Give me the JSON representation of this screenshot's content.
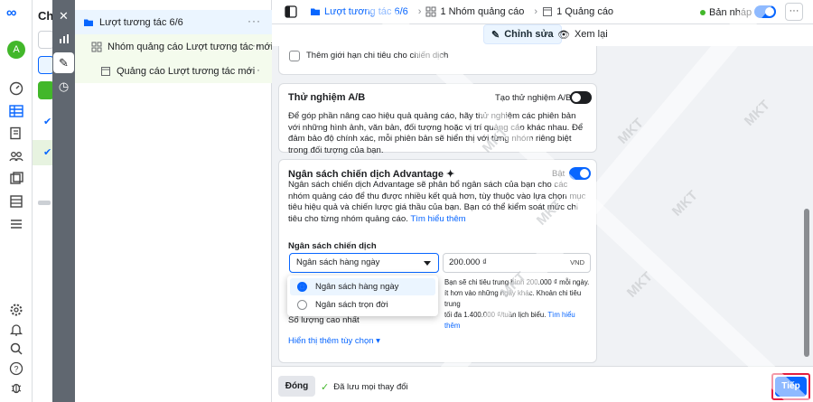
{
  "nav_rail": {
    "avatar_letter": "A",
    "icons": [
      "meta-logo-icon",
      "dashboard-icon",
      "table-icon",
      "documents-icon",
      "audience-icon",
      "catalog-icon",
      "billing-icon",
      "menu-icon",
      "settings-icon",
      "notifications-icon",
      "search-icon",
      "help-icon",
      "bug-icon"
    ]
  },
  "campaign_list": {
    "title": "Chi"
  },
  "tree": {
    "campaign": "Lượt tương tác 6/6",
    "ad_set": "Nhóm quảng cáo Lượt tương tác mới",
    "ad": "Quảng cáo Lượt tương tác mới",
    "more": "···"
  },
  "topbar": {
    "crumb_campaign": "Lượt tương tác 6/6",
    "crumb_adsets": "1 Nhóm quảng cáo",
    "crumb_ads": "1 Quảng cáo",
    "status": "Bản nháp",
    "more": "···"
  },
  "modes": {
    "edit": "Chỉnh sửa",
    "review": "Xem lại"
  },
  "spend_limit": {
    "label": "Thêm giới hạn chi tiêu cho chiến dịch"
  },
  "ab_test": {
    "title": "Thử nghiệm A/B",
    "toggle_label": "Tạo thử nghiệm A/B",
    "description": "Để góp phần nâng cao hiệu quả quảng cáo, hãy thử nghiệm các phiên bản với những hình ảnh, văn bản, đối tượng hoặc vị trí quảng cáo khác nhau. Để đảm bảo độ chính xác, mỗi phiên bản sẽ hiển thị với từng nhóm riêng biệt trong đối tượng của bạn."
  },
  "advantage_budget": {
    "title": "Ngân sách chiến dịch Advantage ✦",
    "toggle_label": "Bật",
    "description": "Ngân sách chiến dịch Advantage sẽ phân bổ ngân sách của bạn cho các nhóm quảng cáo để thu được nhiều kết quả hơn, tùy thuộc vào lựa chọn mục tiêu hiệu quả và chiến lược giá thầu của bạn. Bạn có thể kiểm soát mức chi tiêu cho từng nhóm quảng cáo.",
    "learn_more": "Tìm hiểu thêm",
    "budget_label": "Ngân sách chiến dịch",
    "selected_budget": "Ngân sách hàng ngày",
    "amount": "200.000 ₫",
    "currency": "VND",
    "note_line1": "Bạn sẽ chi tiêu trung bình 200.000 ₫ mỗi ngày. Bạn có thể chi tiêu nhiều",
    "note_line2": "ít hơn vào những ngày khác. Khoản chi tiêu trung",
    "note_line3": "tối đa 1.400.000 ₫/tuần lịch biểu.",
    "note_link": "Tìm hiểu thêm",
    "max_label": "Số lượng cao nhất",
    "more_options": "Hiển thị thêm tùy chọn ▾"
  },
  "budget_dropdown": {
    "options": [
      "Ngân sách hàng ngày",
      "Ngân sách trọn đời"
    ],
    "selected_index": 0
  },
  "footer": {
    "close": "Đóng",
    "saved": "Đã lưu mọi thay đổi",
    "next": "Tiếp"
  },
  "watermark": {
    "text": "MKT"
  },
  "colors": {
    "accent": "#0866ff",
    "success": "#42b72a",
    "highlight_border": "#e41e3f"
  }
}
